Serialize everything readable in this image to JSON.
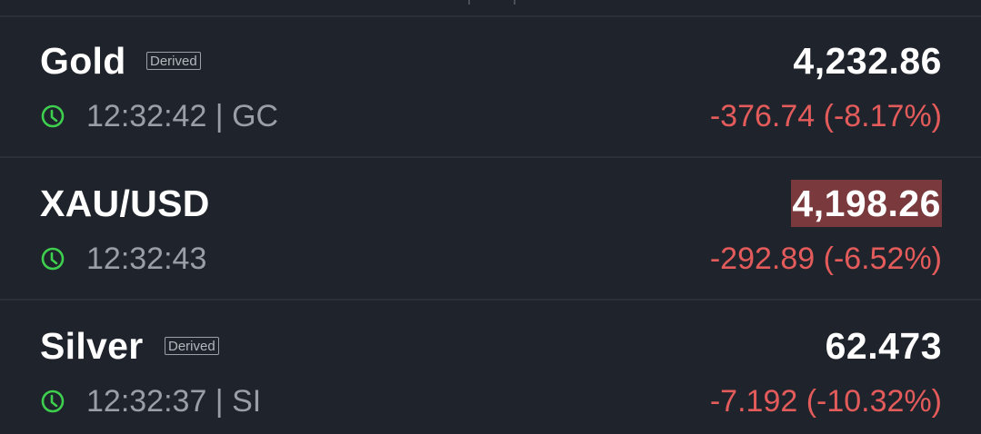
{
  "quotes": [
    {
      "name": "Gold",
      "badge": "Derived",
      "time_symbol": "12:32:42 | GC",
      "price": "4,232.86",
      "change": "-376.74 (-8.17%)"
    },
    {
      "name": "XAU/USD",
      "badge": "",
      "time_symbol": "12:32:43",
      "price": "4,198.26",
      "change": "-292.89 (-6.52%)"
    },
    {
      "name": "Silver",
      "badge": "Derived",
      "time_symbol": "12:32:37 | SI",
      "price": "62.473",
      "change": "-7.192 (-10.32%)"
    }
  ],
  "colors": {
    "background": "#1f232b",
    "negative": "#e35b5b",
    "clock": "#3ecf4f",
    "price_flash_down": "#7a3a3d"
  },
  "icons": {
    "market_open": "clock-icon"
  }
}
